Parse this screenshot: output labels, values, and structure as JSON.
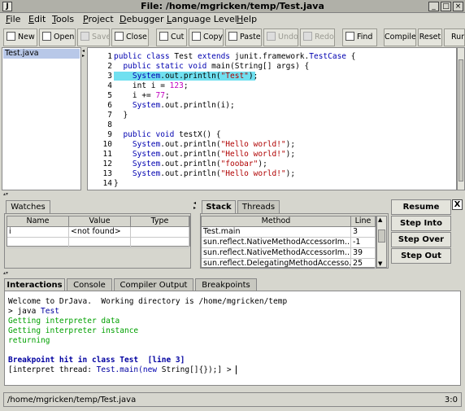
{
  "window": {
    "title": "File: /home/mgricken/temp/Test.java",
    "app_icon": "J"
  },
  "menu": [
    "File",
    "Edit",
    "Tools",
    "Project",
    "Debugger",
    "Language Level",
    "Help"
  ],
  "toolbar": [
    {
      "label": "New",
      "icon": "new-file-icon",
      "enabled": true
    },
    {
      "label": "Open",
      "icon": "open-folder-icon",
      "enabled": true
    },
    {
      "label": "Save",
      "icon": "save-disk-icon",
      "enabled": false
    },
    {
      "label": "Close",
      "icon": "close-file-icon",
      "enabled": true
    },
    {
      "label": "Cut",
      "icon": "scissors-icon",
      "enabled": true
    },
    {
      "label": "Copy",
      "icon": "copy-icon",
      "enabled": true
    },
    {
      "label": "Paste",
      "icon": "paste-clipboard-icon",
      "enabled": true
    },
    {
      "label": "Undo",
      "icon": "undo-icon",
      "enabled": false
    },
    {
      "label": "Redo",
      "icon": "redo-icon",
      "enabled": false
    },
    {
      "label": "Find",
      "icon": "binoculars-icon",
      "enabled": true
    },
    {
      "label": "Compile",
      "enabled": true
    },
    {
      "label": "Reset",
      "enabled": true
    },
    {
      "label": "Run",
      "enabled": true
    }
  ],
  "files": [
    "Test.java"
  ],
  "editor": {
    "lines": [
      {
        "n": "1",
        "text": "public class Test extends junit.framework.TestCase {"
      },
      {
        "n": "2",
        "text": "  public static void main(String[] args) {"
      },
      {
        "n": "3",
        "text": "    System.out.println(\"Test\");",
        "highlight": true
      },
      {
        "n": "4",
        "text": "    int i = 123;"
      },
      {
        "n": "5",
        "text": "    i += 77;"
      },
      {
        "n": "6",
        "text": "    System.out.println(i);"
      },
      {
        "n": "7",
        "text": "  }"
      },
      {
        "n": "8",
        "text": ""
      },
      {
        "n": "9",
        "text": "  public void testX() {"
      },
      {
        "n": "10",
        "text": "    System.out.println(\"Hello world!\");"
      },
      {
        "n": "11",
        "text": "    System.out.println(\"Hello world!\");"
      },
      {
        "n": "12",
        "text": "    System.out.println(\"foobar\");"
      },
      {
        "n": "13",
        "text": "    System.out.println(\"Hello world!\");"
      },
      {
        "n": "14",
        "text": "}"
      }
    ]
  },
  "watches": {
    "tab": "Watches",
    "columns": [
      "Name",
      "Value",
      "Type"
    ],
    "rows": [
      [
        "i",
        "<not found>",
        ""
      ],
      [
        "",
        "",
        ""
      ]
    ]
  },
  "stack": {
    "tabs": [
      "Stack",
      "Threads"
    ],
    "columns": [
      "Method",
      "Line"
    ],
    "rows": [
      [
        "Test.main",
        "3"
      ],
      [
        "sun.reflect.NativeMethodAccessorIm...",
        "-1"
      ],
      [
        "sun.reflect.NativeMethodAccessorIm...",
        "39"
      ],
      [
        "sun.reflect.DelegatingMethodAccesso...",
        "25"
      ]
    ]
  },
  "debug_buttons": [
    "Resume",
    "Step Into",
    "Step Over",
    "Step Out"
  ],
  "close_glyph": "X",
  "bottom_tabs": [
    "Interactions",
    "Console",
    "Compiler Output",
    "Breakpoints"
  ],
  "console": {
    "welcome": "Welcome to DrJava.  Working directory is /home/mgricken/temp",
    "cmd_prompt": "> java ",
    "cmd_class": "Test",
    "l_getdebug": "Getting interpreter data",
    "l_getinst": "Getting interpreter instance",
    "l_returning": "returning",
    "breakpoint": "Breakpoint hit in class Test  [line 3]",
    "interp_prefix": "[interpret thread: ",
    "interp_main": "Test.main(",
    "interp_new": "new",
    "interp_rest": " String[]{});] > "
  },
  "status": {
    "path": "/home/mgricken/temp/Test.java",
    "position": "3:0"
  },
  "colors": {
    "highlight": "#70e0f0",
    "keyword": "#0000b0",
    "string": "#b00000",
    "number": "#c000c0",
    "console_green": "#00a000",
    "console_blue": "#0000a0"
  }
}
